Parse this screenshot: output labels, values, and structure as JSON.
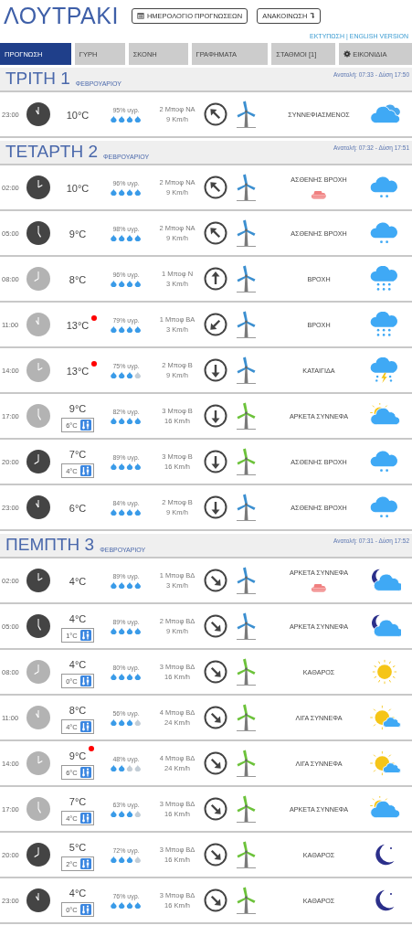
{
  "title": "ΛΟΥΤΡΑΚΙ",
  "header_buttons": [
    {
      "label": "ΗΜΕΡΟΛΟΓΙΟ ΠΡΟΓΝΩΣΕΩΝ",
      "kind": "calendar"
    },
    {
      "label": "ΑΝΑΚΟΙΝΩΣΗ",
      "kind": "announcement"
    }
  ],
  "links": [
    "ΕΚΤΥΠΩΣΗ",
    "|",
    "ENGLISH VERSION"
  ],
  "tabs": [
    {
      "label": "ΠΡΟΓΝΩΣΗ",
      "selected": true,
      "kind": "plain"
    },
    {
      "label": "ΓΥΡΗ",
      "selected": false,
      "kind": "plain"
    },
    {
      "label": "ΣΚΟΝΗ",
      "selected": false,
      "kind": "plain"
    },
    {
      "label": "ΓΡΑΦΗΜΑΤΑ",
      "selected": false,
      "kind": "plain"
    },
    {
      "label": "ΣΤΑΘΜΟΙ [1]",
      "selected": false,
      "kind": "plain"
    },
    {
      "label": "ΕΙΚΟΝΙΔΙΑ",
      "selected": false,
      "kind": "settings"
    }
  ],
  "days": [
    {
      "day": "ΤΡΙΤΗ 1",
      "month": "ΦΕΒΡΟΥΑΡΙΟΥ",
      "sun": "Ανατολή: 07:33  - Δύση 17:50",
      "rows": [
        {
          "time": "23:00",
          "night": true,
          "temp": "10°C",
          "alert": false,
          "humidity": "95% υγρ.",
          "stars": 4,
          "wind": {
            "beaufort": "2 Μποφ ΝΑ",
            "speed": "9 Km/h",
            "kind": "up-left"
          },
          "color": "#3b8fd0",
          "condition": "ΣΥΝΝΕΦΙΑΣΜΕΝΟΣ",
          "warning": false,
          "kind": "cloudy"
        }
      ]
    },
    {
      "day": "ΤΕΤΑΡΤΗ 2",
      "month": "ΦΕΒΡΟΥΑΡΙΟΥ",
      "sun": "Ανατολή: 07:32  - Δύση 17:51",
      "rows": [
        {
          "time": "02:00",
          "night": true,
          "temp": "10°C",
          "alert": false,
          "humidity": "96% υγρ.",
          "stars": 4,
          "wind": {
            "beaufort": "2 Μποφ ΝΑ",
            "speed": "9 Km/h",
            "kind": "up-left"
          },
          "color": "#3b8fd0",
          "condition": "ΑΣΘΕΝΗΣ ΒΡΟΧΗ",
          "warning": true,
          "kind": "light-rain"
        },
        {
          "time": "05:00",
          "night": true,
          "temp": "9°C",
          "alert": false,
          "humidity": "98% υγρ.",
          "stars": 4,
          "wind": {
            "beaufort": "2 Μποφ ΝΑ",
            "speed": "9 Km/h",
            "kind": "up-left"
          },
          "color": "#3b8fd0",
          "condition": "ΑΣΘΕΝΗΣ ΒΡΟΧΗ",
          "warning": false,
          "kind": "light-rain"
        },
        {
          "time": "08:00",
          "night": false,
          "temp": "8°C",
          "alert": false,
          "humidity": "96% υγρ.",
          "stars": 4,
          "wind": {
            "beaufort": "1 Μποφ Ν",
            "speed": "3 Km/h",
            "kind": "up"
          },
          "color": "#3b8fd0",
          "condition": "ΒΡΟΧΗ",
          "warning": false,
          "kind": "rain"
        },
        {
          "time": "11:00",
          "night": false,
          "temp": "13°C",
          "alert": true,
          "humidity": "79% υγρ.",
          "stars": 4,
          "wind": {
            "beaufort": "1 Μποφ ΒΑ",
            "speed": "3 Km/h",
            "kind": "down-left"
          },
          "color": "#3b8fd0",
          "condition": "ΒΡΟΧΗ",
          "warning": false,
          "kind": "rain"
        },
        {
          "time": "14:00",
          "night": false,
          "temp": "13°C",
          "alert": true,
          "humidity": "75% υγρ.",
          "stars": 3,
          "wind": {
            "beaufort": "2 Μποφ Β",
            "speed": "9 Km/h",
            "kind": "down"
          },
          "color": "#3b8fd0",
          "condition": "ΚΑΤΑΙΓΙΔΑ",
          "warning": false,
          "kind": "storm"
        },
        {
          "time": "17:00",
          "night": false,
          "temp": "9°C",
          "feels": "6°C",
          "alert": false,
          "humidity": "82% υγρ.",
          "stars": 4,
          "wind": {
            "beaufort": "3 Μποφ Β",
            "speed": "16 Km/h",
            "kind": "down"
          },
          "color": "#6cc23a",
          "condition": "ΑΡΚΕΤΑ ΣΥΝΝΕΦΑ",
          "warning": false,
          "kind": "partly-day"
        },
        {
          "time": "20:00",
          "night": true,
          "temp": "7°C",
          "feels": "4°C",
          "alert": false,
          "humidity": "89% υγρ.",
          "stars": 4,
          "wind": {
            "beaufort": "3 Μποφ Β",
            "speed": "16 Km/h",
            "kind": "down"
          },
          "color": "#6cc23a",
          "condition": "ΑΣΘΕΝΗΣ ΒΡΟΧΗ",
          "warning": false,
          "kind": "light-rain"
        },
        {
          "time": "23:00",
          "night": true,
          "temp": "6°C",
          "alert": false,
          "humidity": "84% υγρ.",
          "stars": 4,
          "wind": {
            "beaufort": "2 Μποφ Β",
            "speed": "9 Km/h",
            "kind": "down"
          },
          "color": "#3b8fd0",
          "condition": "ΑΣΘΕΝΗΣ ΒΡΟΧΗ",
          "warning": false,
          "kind": "light-rain"
        }
      ]
    },
    {
      "day": "ΠΕΜΠΤΗ 3",
      "month": "ΦΕΒΡΟΥΑΡΙΟΥ",
      "sun": "Ανατολή: 07:31  - Δύση 17:52",
      "rows": [
        {
          "time": "02:00",
          "night": true,
          "temp": "4°C",
          "alert": false,
          "humidity": "89% υγρ.",
          "stars": 4,
          "wind": {
            "beaufort": "1 Μποφ ΒΔ",
            "speed": "3 Km/h",
            "kind": "down-right"
          },
          "color": "#3b8fd0",
          "condition": "ΑΡΚΕΤΑ ΣΥΝΝΕΦΑ",
          "warning": true,
          "kind": "partly-night"
        },
        {
          "time": "05:00",
          "night": true,
          "temp": "4°C",
          "feels": "1°C",
          "alert": false,
          "humidity": "89% υγρ.",
          "stars": 4,
          "wind": {
            "beaufort": "2 Μποφ ΒΔ",
            "speed": "9 Km/h",
            "kind": "down-right"
          },
          "color": "#3b8fd0",
          "condition": "ΑΡΚΕΤΑ ΣΥΝΝΕΦΑ",
          "warning": false,
          "kind": "partly-night"
        },
        {
          "time": "08:00",
          "night": false,
          "temp": "4°C",
          "feels": "0°C",
          "alert": false,
          "humidity": "80% υγρ.",
          "stars": 4,
          "wind": {
            "beaufort": "3 Μποφ ΒΔ",
            "speed": "16 Km/h",
            "kind": "down-right"
          },
          "color": "#6cc23a",
          "condition": "ΚΑΘΑΡΟΣ",
          "warning": false,
          "kind": "clear-day"
        },
        {
          "time": "11:00",
          "night": false,
          "temp": "8°C",
          "feels": "4°C",
          "alert": false,
          "humidity": "56% υγρ.",
          "stars": 3,
          "wind": {
            "beaufort": "4 Μποφ ΒΔ",
            "speed": "24 Km/h",
            "kind": "down-right"
          },
          "color": "#6cc23a",
          "condition": "ΛΙΓΑ ΣΥΝΝΕΦΑ",
          "warning": false,
          "kind": "few-clouds"
        },
        {
          "time": "14:00",
          "night": false,
          "temp": "9°C",
          "feels": "6°C",
          "alert": true,
          "humidity": "48% υγρ.",
          "stars": 2,
          "wind": {
            "beaufort": "4 Μποφ ΒΔ",
            "speed": "24 Km/h",
            "kind": "down-right"
          },
          "color": "#6cc23a",
          "condition": "ΛΙΓΑ ΣΥΝΝΕΦΑ",
          "warning": false,
          "kind": "few-clouds"
        },
        {
          "time": "17:00",
          "night": false,
          "temp": "7°C",
          "feels": "4°C",
          "alert": false,
          "humidity": "63% υγρ.",
          "stars": 3,
          "wind": {
            "beaufort": "3 Μποφ ΒΔ",
            "speed": "16 Km/h",
            "kind": "down-right"
          },
          "color": "#6cc23a",
          "condition": "ΑΡΚΕΤΑ ΣΥΝΝΕΦΑ",
          "warning": false,
          "kind": "partly-day"
        },
        {
          "time": "20:00",
          "night": true,
          "temp": "5°C",
          "feels": "2°C",
          "alert": false,
          "humidity": "72% υγρ.",
          "stars": 3,
          "wind": {
            "beaufort": "3 Μποφ ΒΔ",
            "speed": "16 Km/h",
            "kind": "down-right"
          },
          "color": "#6cc23a",
          "condition": "ΚΑΘΑΡΟΣ",
          "warning": false,
          "kind": "clear-night"
        },
        {
          "time": "23:00",
          "night": true,
          "temp": "4°C",
          "feels": "0°C",
          "alert": false,
          "humidity": "76% υγρ.",
          "stars": 4,
          "wind": {
            "beaufort": "3 Μποφ ΒΔ",
            "speed": "16 Km/h",
            "kind": "down-right"
          },
          "color": "#6cc23a",
          "condition": "ΚΑΘΑΡΟΣ",
          "warning": false,
          "kind": "clear-night"
        }
      ]
    }
  ]
}
